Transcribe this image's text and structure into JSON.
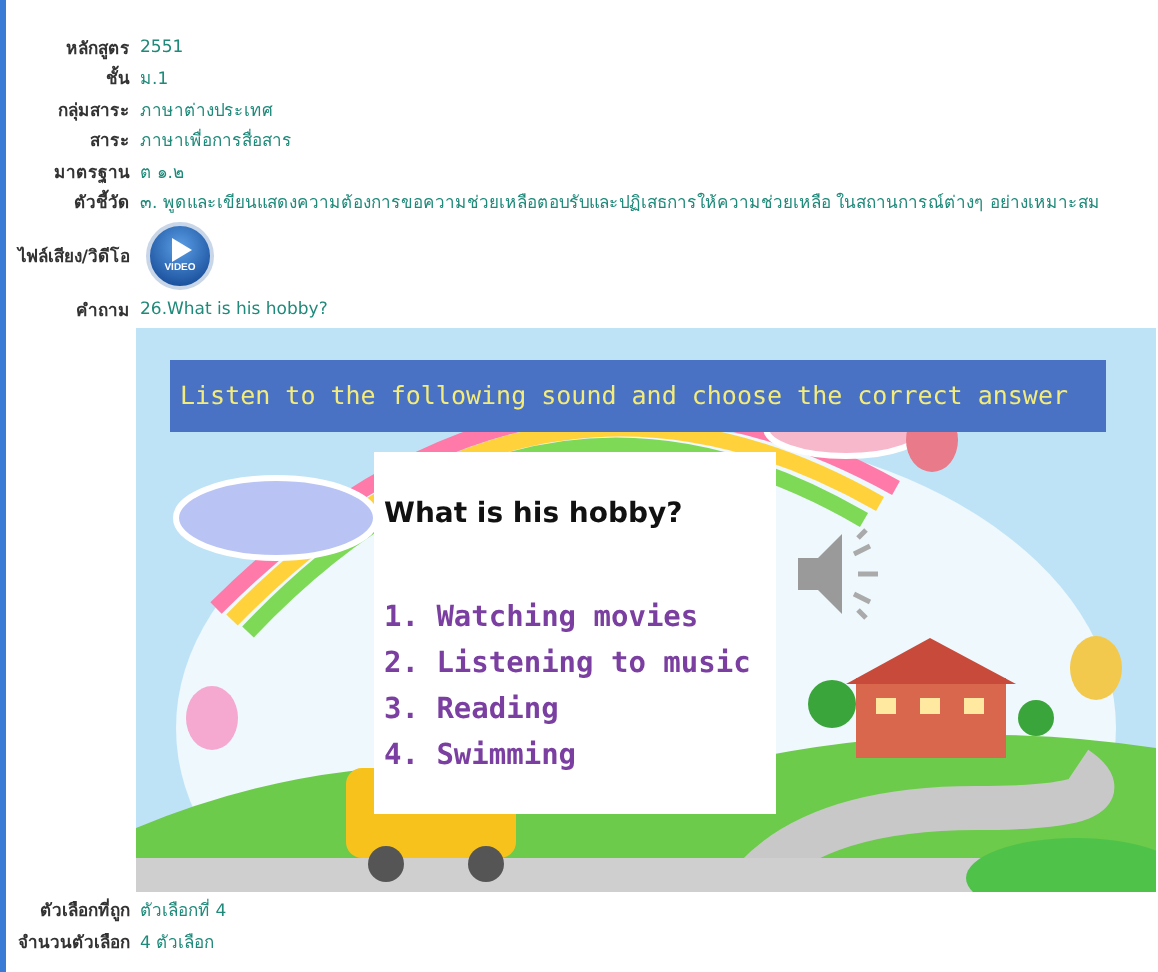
{
  "rows": [
    {
      "kind": "text",
      "label": "หลักสูตร",
      "value": "2551"
    },
    {
      "kind": "text",
      "label": "ชั้น",
      "value": "ม.1"
    },
    {
      "kind": "text",
      "label": "กลุ่มสาระ",
      "value": "ภาษาต่างประเทศ"
    },
    {
      "kind": "text",
      "label": "สาระ",
      "value": "ภาษาเพื่อการสื่อสาร"
    },
    {
      "kind": "text",
      "label": "มาตรฐาน",
      "value": "ต ๑.๒"
    },
    {
      "kind": "text",
      "label": "ตัวชี้วัด",
      "value": "๓. พูดและเขียนแสดงความต้องการขอความช่วยเหลือตอบรับและปฏิเสธการให้ความช่วยเหลือ ในสถานการณ์ต่างๆ อย่างเหมาะสม"
    },
    {
      "kind": "video",
      "label": "ไฟล์เสียง/วิดีโอ",
      "value": "VIDEO"
    },
    {
      "kind": "text",
      "label": "คำถาม",
      "value": "26.What is his hobby?"
    },
    {
      "kind": "slide",
      "instruction": "Listen to the following sound and choose the correct answer",
      "question": "What is his hobby?",
      "options": [
        "1. Watching movies",
        "2. Listening to music",
        "3. Reading",
        "4. Swimming"
      ]
    },
    {
      "kind": "text",
      "label": "ตัวเลือกที่ถูก",
      "value": "ตัวเลือกที่ 4"
    },
    {
      "kind": "text",
      "label": "จำนวนตัวเลือก",
      "value": "4 ตัวเลือก"
    }
  ]
}
